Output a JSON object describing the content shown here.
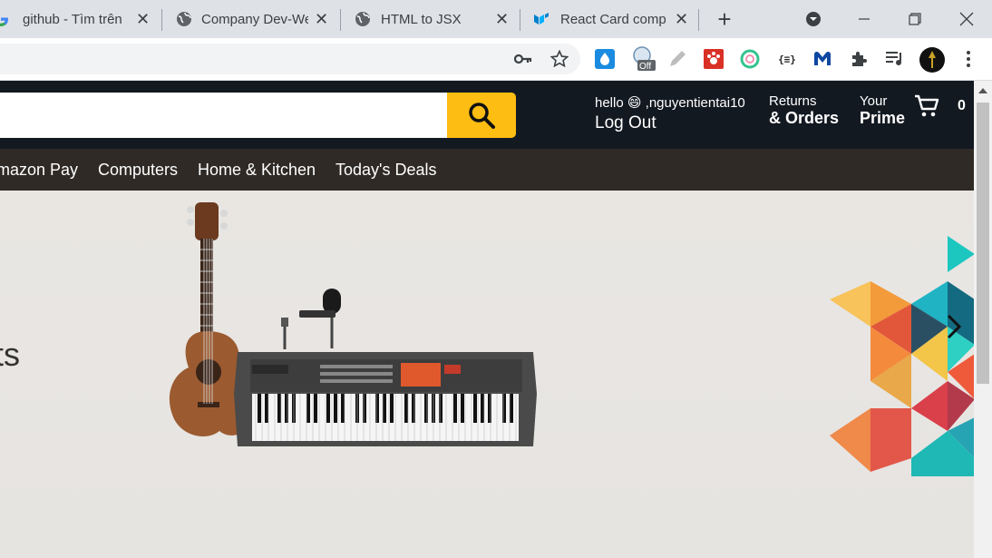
{
  "browser": {
    "tabs": [
      {
        "title": "github - Tìm trên"
      },
      {
        "title": "Company Dev-We"
      },
      {
        "title": "HTML to JSX"
      },
      {
        "title": "React Card compo"
      }
    ],
    "new_tab_symbol": "+",
    "extension_badge": "Off"
  },
  "header": {
    "search_placeholder": "",
    "greeting": "hello 😄 ,nguyentientai10",
    "logout": "Log Out",
    "returns_line1": "Returns",
    "returns_line2": "& Orders",
    "prime_line1": "Your",
    "prime_line2": "Prime",
    "cart_count": "0"
  },
  "nav": {
    "items": [
      "mazon Pay",
      "Computers",
      "Home & Kitchen",
      "Today's Deals"
    ]
  },
  "hero": {
    "partial_text": "ts"
  },
  "colors": {
    "header_bg": "#131921",
    "nav_bg": "#2f2a26",
    "search_button": "#febd12"
  }
}
